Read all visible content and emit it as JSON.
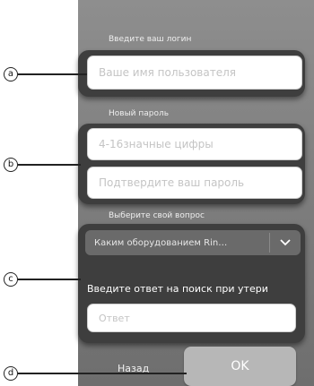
{
  "login": {
    "label": "Введите ваш логин",
    "username_placeholder": "Ваше имя пользователя"
  },
  "password": {
    "label": "Новый пароль",
    "new_placeholder": "4-16значные цифры",
    "confirm_placeholder": "Подтвердите ваш пароль"
  },
  "security": {
    "label": "Выберите свой вопрос",
    "question_selected": "Каким оборудованием Rin…",
    "answer_label": "Введите ответ на поиск при утери",
    "answer_placeholder": "Ответ"
  },
  "actions": {
    "back_label": "Назад",
    "ok_label": "OK"
  },
  "callouts": [
    "a",
    "b",
    "c",
    "d"
  ],
  "icons": {
    "dropdown": "chevron-down-icon"
  }
}
